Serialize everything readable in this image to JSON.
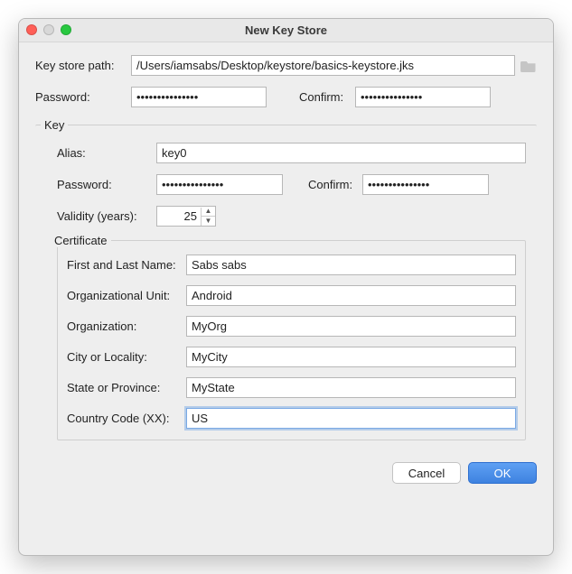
{
  "title": "New Key Store",
  "keystore": {
    "path_label": "Key store path:",
    "path_value": "/Users/iamsabs/Desktop/keystore/basics-keystore.jks",
    "password_label": "Password:",
    "password_value": "•••••••••••••••",
    "confirm_label": "Confirm:",
    "confirm_value": "•••••••••••••••"
  },
  "key": {
    "legend": "Key",
    "alias_label": "Alias:",
    "alias_value": "key0",
    "password_label": "Password:",
    "password_value": "•••••••••••••••",
    "confirm_label": "Confirm:",
    "confirm_value": "•••••••••••••••",
    "validity_label": "Validity (years):",
    "validity_value": "25"
  },
  "certificate": {
    "legend": "Certificate",
    "first_last_label": "First and Last Name:",
    "first_last_value": "Sabs sabs",
    "org_unit_label": "Organizational Unit:",
    "org_unit_value": "Android",
    "organization_label": "Organization:",
    "organization_value": "MyOrg",
    "city_label": "City or Locality:",
    "city_value": "MyCity",
    "state_label": "State or Province:",
    "state_value": "MyState",
    "country_label": "Country Code (XX):",
    "country_value": "US"
  },
  "buttons": {
    "cancel": "Cancel",
    "ok": "OK"
  }
}
